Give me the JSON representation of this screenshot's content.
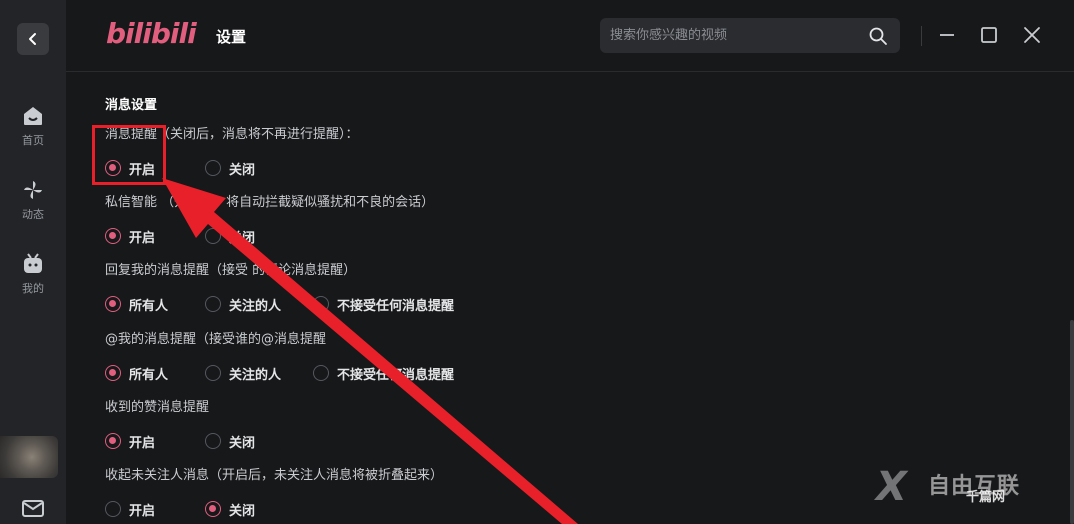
{
  "app": {
    "logo_text": "bilibili",
    "page_title": "设置",
    "accent_color": "#e25e7f"
  },
  "rail": {
    "items": [
      {
        "label": "首页",
        "icon": "tv-home-icon"
      },
      {
        "label": "动态",
        "icon": "pinwheel-icon"
      },
      {
        "label": "我的",
        "icon": "tv-profile-icon"
      }
    ]
  },
  "search": {
    "placeholder": "搜索你感兴趣的视频"
  },
  "content": {
    "section_title": "消息设置",
    "settings": [
      {
        "title": "消息提醒（关闭后，消息将不再进行提醒）：",
        "options": [
          "开启",
          "关闭"
        ],
        "selected": 0
      },
      {
        "title": "私信智能      （开启后，将自动拦截疑似骚扰和不良的会话）",
        "options": [
          "开启",
          "关闭"
        ],
        "selected": 0
      },
      {
        "title": "回复我的消息提醒（接受     的评论消息提醒）",
        "options": [
          "所有人",
          "关注的人",
          "不接受任何消息提醒"
        ],
        "selected": 0
      },
      {
        "title": "@我的消息提醒（接受谁的@消息提醒",
        "options": [
          "所有人",
          "关注的人",
          "不接受任何消息提醒"
        ],
        "selected": 0
      },
      {
        "title": "收到的赞消息提醒",
        "options": [
          "开启",
          "关闭"
        ],
        "selected": 0
      },
      {
        "title": "收起未关注人消息（开启后，未关注人消息将被折叠起来）",
        "options": [
          "开启",
          "关闭"
        ],
        "selected": 1
      }
    ]
  },
  "watermark": {
    "big": "自由互联",
    "small": "千篇网"
  }
}
